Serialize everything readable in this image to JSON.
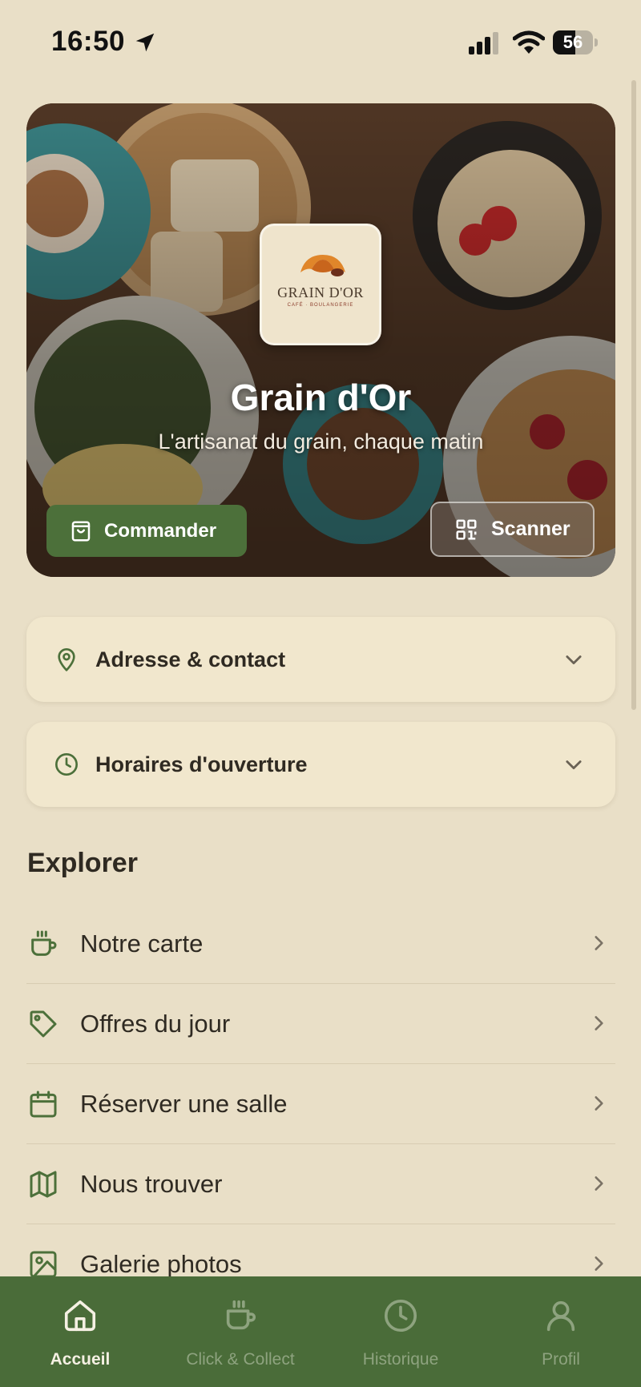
{
  "status_bar": {
    "time": "16:50",
    "battery": "56",
    "battery_level": 0.56
  },
  "hero": {
    "logo_name": "GRAIN D'OR",
    "logo_subtitle": "CAFÉ · BOULANGERIE",
    "title": "Grain d'Or",
    "tagline": "L'artisanat du grain, chaque matin",
    "order_button": "Commander",
    "scan_button": "Scanner"
  },
  "accordions": {
    "address": {
      "label": "Adresse & contact",
      "icon": "map-pin-icon"
    },
    "hours": {
      "label": "Horaires d'ouverture",
      "icon": "clock-icon"
    }
  },
  "explore": {
    "title": "Explorer",
    "items": [
      {
        "label": "Notre carte",
        "icon": "coffee-cup-icon"
      },
      {
        "label": "Offres du jour",
        "icon": "tag-icon"
      },
      {
        "label": "Réserver une salle",
        "icon": "calendar-icon"
      },
      {
        "label": "Nous trouver",
        "icon": "map-icon"
      },
      {
        "label": "Galerie photos",
        "icon": "image-icon"
      }
    ]
  },
  "tab_bar": {
    "tabs": [
      {
        "label": "Accueil",
        "icon": "home-icon",
        "active": true
      },
      {
        "label": "Click & Collect",
        "icon": "coffee-cup-icon",
        "active": false
      },
      {
        "label": "Historique",
        "icon": "clock-icon",
        "active": false
      },
      {
        "label": "Profil",
        "icon": "user-icon",
        "active": false
      }
    ]
  },
  "colors": {
    "background": "#e9dfc7",
    "card": "#f1e7cd",
    "accent_green": "#4c703a",
    "tab_bar": "#4a6c39",
    "text": "#2f2a22"
  }
}
